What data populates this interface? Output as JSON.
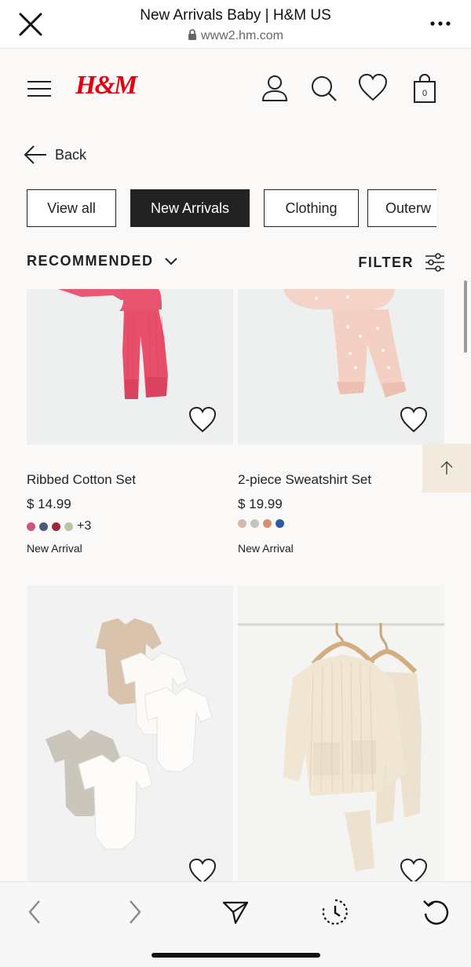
{
  "browser": {
    "title": "New Arrivals Baby | H&M US",
    "url": "www2.hm.com"
  },
  "header": {
    "logo": "H&M",
    "bag_count": "0"
  },
  "nav": {
    "back_label": "Back"
  },
  "categories": [
    {
      "label": "View all",
      "active": false
    },
    {
      "label": "New Arrivals",
      "active": true
    },
    {
      "label": "Clothing",
      "active": false
    },
    {
      "label": "Outerw",
      "active": false
    }
  ],
  "toolbar": {
    "sort_label": "RECOMMENDED",
    "filter_label": "FILTER"
  },
  "products": [
    {
      "name": "Ribbed Cotton Set",
      "price": "$ 14.99",
      "swatches": [
        "#c75883",
        "#4c5a7a",
        "#9a2a3a",
        "#b9c3a7"
      ],
      "more_colors": "+3",
      "badge": "New Arrival"
    },
    {
      "name": "2-piece Sweatshirt Set",
      "price": "$ 19.99",
      "swatches": [
        "#d4b8b0",
        "#c4c4bd",
        "#d78f73",
        "#2c5b9b"
      ],
      "more_colors": "",
      "badge": "New Arrival"
    },
    {
      "name": "",
      "price": "",
      "swatches": [],
      "more_colors": "",
      "badge": ""
    },
    {
      "name": "",
      "price": "",
      "swatches": [],
      "more_colors": "",
      "badge": ""
    }
  ],
  "colors": {
    "brand_red": "#e50010",
    "chip_active_bg": "#222222",
    "scroll_top_bg": "#f2eadc"
  },
  "icons": {
    "close": "close-icon",
    "lock": "lock-icon",
    "more": "more-icon",
    "menu": "hamburger-icon",
    "account": "account-icon",
    "search": "search-icon",
    "favorites": "heart-icon",
    "bag": "shopping-bag-icon",
    "back": "arrow-left-icon",
    "sort": "chevron-down-icon",
    "filter": "sliders-icon",
    "scroll_top": "arrow-up-icon",
    "browser_back": "chevron-left-icon",
    "browser_forward": "chevron-right-icon",
    "share": "send-icon",
    "history": "history-icon",
    "reload": "reload-icon"
  }
}
